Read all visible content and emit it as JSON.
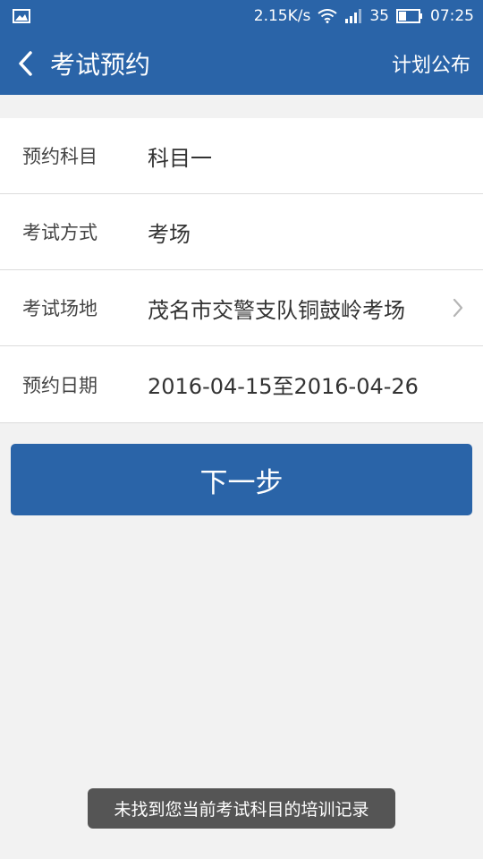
{
  "status_bar": {
    "net_speed": "2.15K/s",
    "battery_level": "35",
    "time": "07:25",
    "icons": [
      "image-icon",
      "wifi-icon",
      "signal-icon",
      "battery-icon"
    ]
  },
  "app_bar": {
    "title": "考试预约",
    "action": "计划公布"
  },
  "form": {
    "rows": [
      {
        "label": "预约科目",
        "value": "科目一"
      },
      {
        "label": "考试方式",
        "value": "考场"
      },
      {
        "label": "考试场地",
        "value": "茂名市交警支队铜鼓岭考场"
      },
      {
        "label": "预约日期",
        "value": "2016-04-15至2016-04-26"
      }
    ]
  },
  "next_button": {
    "label": "下一步"
  },
  "toast": {
    "message": "未找到您当前考试科目的培训记录"
  },
  "colors": {
    "primary": "#2a64a8",
    "background": "#f2f2f2",
    "toast": "#555555"
  }
}
